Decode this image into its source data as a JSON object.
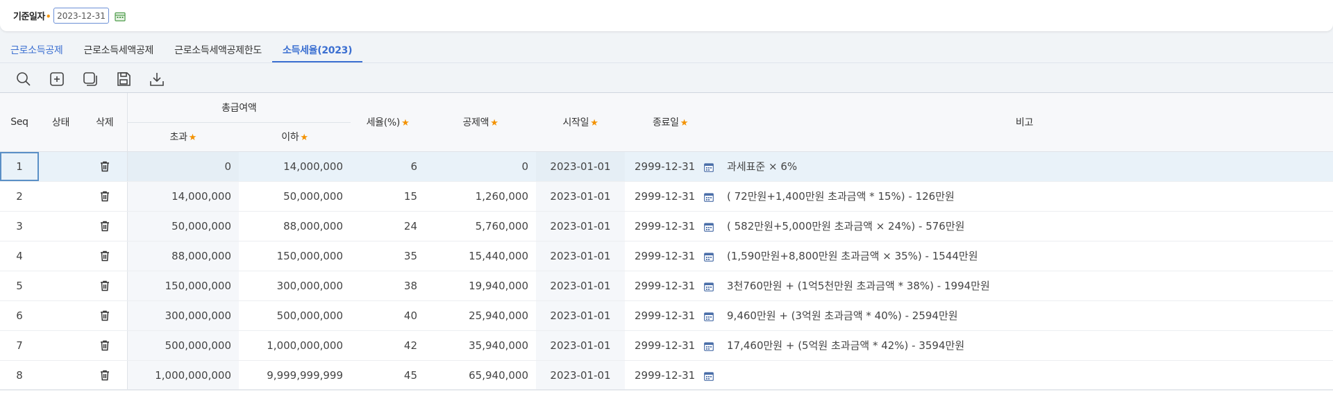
{
  "filter": {
    "label": "기준일자",
    "required_mark": "•",
    "date_value": "2023-12-31"
  },
  "tabs": [
    {
      "label": "근로소득공제"
    },
    {
      "label": "근로소득세액공제"
    },
    {
      "label": "근로소득세액공제한도"
    },
    {
      "label": "소득세율(2023)"
    }
  ],
  "toolbar": {
    "icons": [
      "search-icon",
      "add-icon",
      "copy-icon",
      "save-icon",
      "download-icon"
    ]
  },
  "grid": {
    "headers": {
      "seq": "Seq",
      "status": "상태",
      "delete": "삭제",
      "total_pay": "총급여액",
      "over": "초과",
      "under": "이하",
      "tax_rate": "세율(%)",
      "deduction": "공제액",
      "start_date": "시작일",
      "end_date": "종료일",
      "note": "비고",
      "required_mark": "★"
    },
    "rows": [
      {
        "seq": "1",
        "over": "0",
        "under": "14,000,000",
        "rate": "6",
        "deduction": "0",
        "start": "2023-01-01",
        "end": "2999-12-31",
        "note": "과세표준 × 6%"
      },
      {
        "seq": "2",
        "over": "14,000,000",
        "under": "50,000,000",
        "rate": "15",
        "deduction": "1,260,000",
        "start": "2023-01-01",
        "end": "2999-12-31",
        "note": "( 72만원+1,400만원 초과금액 * 15%) - 126만원"
      },
      {
        "seq": "3",
        "over": "50,000,000",
        "under": "88,000,000",
        "rate": "24",
        "deduction": "5,760,000",
        "start": "2023-01-01",
        "end": "2999-12-31",
        "note": "( 582만원+5,000만원 초과금액 × 24%) - 576만원"
      },
      {
        "seq": "4",
        "over": "88,000,000",
        "under": "150,000,000",
        "rate": "35",
        "deduction": "15,440,000",
        "start": "2023-01-01",
        "end": "2999-12-31",
        "note": "(1,590만원+8,800만원 초과금액 × 35%) - 1544만원"
      },
      {
        "seq": "5",
        "over": "150,000,000",
        "under": "300,000,000",
        "rate": "38",
        "deduction": "19,940,000",
        "start": "2023-01-01",
        "end": "2999-12-31",
        "note": "3천760만원 + (1억5천만원 초과금액 * 38%) - 1994만원"
      },
      {
        "seq": "6",
        "over": "300,000,000",
        "under": "500,000,000",
        "rate": "40",
        "deduction": "25,940,000",
        "start": "2023-01-01",
        "end": "2999-12-31",
        "note": "9,460만원 + (3억원 초과금액 * 40%) - 2594만원"
      },
      {
        "seq": "7",
        "over": "500,000,000",
        "under": "1,000,000,000",
        "rate": "42",
        "deduction": "35,940,000",
        "start": "2023-01-01",
        "end": "2999-12-31",
        "note": "17,460만원 + (5억원 초과금액 * 42%) - 3594만원"
      },
      {
        "seq": "8",
        "over": "1,000,000,000",
        "under": "9,999,999,999",
        "rate": "45",
        "deduction": "65,940,000",
        "start": "2023-01-01",
        "end": "2999-12-31",
        "note": ""
      }
    ]
  },
  "colors": {
    "accent": "#3b6fd1",
    "required": "#f39200",
    "selected_row": "#e9f2f9"
  }
}
